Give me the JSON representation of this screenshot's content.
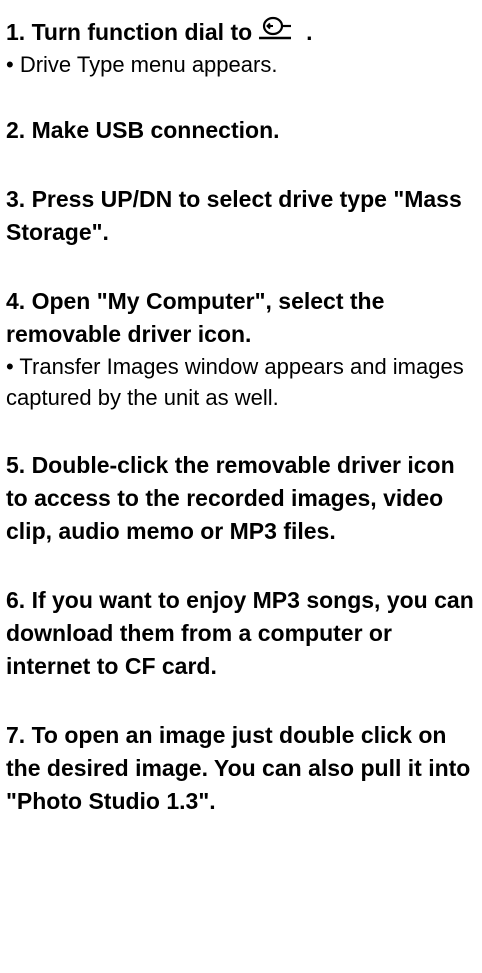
{
  "steps": [
    {
      "title": "1. Turn function dial to",
      "title_suffix": ".",
      "icon": "usb-connection-icon",
      "note": "• Drive Type menu appears."
    },
    {
      "title": "2. Make USB connection."
    },
    {
      "title": "3. Press UP/DN to select drive type \"Mass Storage\"."
    },
    {
      "title": "4. Open \"My Computer\", select the removable driver icon.",
      "note": "• Transfer Images window appears and images captured by the unit as well."
    },
    {
      "title": "5. Double-click the removable driver icon to access to the recorded images, video clip, audio memo or MP3 files."
    },
    {
      "title": "6. If you want to enjoy MP3 songs, you can download them from a computer or internet to CF card."
    },
    {
      "title": "7. To open an image just double click on the desired image. You can also pull it into \"Photo Studio 1.3\"."
    }
  ]
}
